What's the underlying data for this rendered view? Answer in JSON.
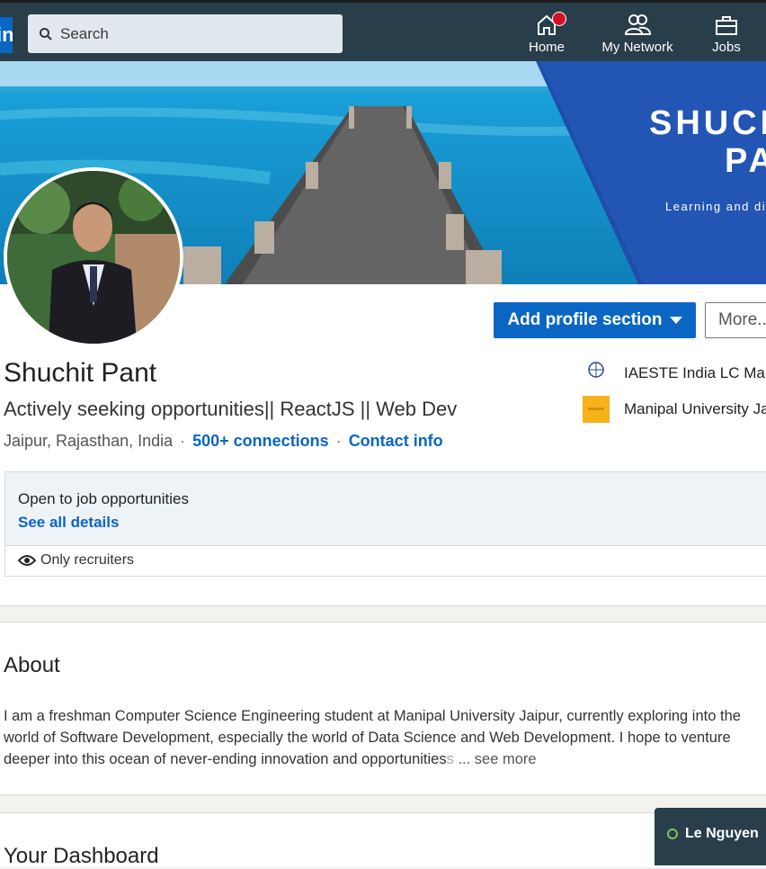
{
  "nav": {
    "logo_text": "in",
    "search_placeholder": "Search",
    "items": [
      {
        "label": "Home"
      },
      {
        "label": "My Network"
      },
      {
        "label": "Jobs"
      }
    ]
  },
  "profile": {
    "banner_title_line1": "SHUCHIT",
    "banner_title_line2": "PANT",
    "banner_tagline": "Learning and discovering",
    "name": "Shuchit Pant",
    "headline": "Actively seeking opportunities|| ReactJS || Web Dev",
    "location": "Jaipur, Rajasthan, India",
    "connections": "500+ connections",
    "contact": "Contact info",
    "add_section_label": "Add profile section",
    "more_label": "More...",
    "orgs": [
      {
        "name": "IAESTE India LC Manipal",
        "logo_text": "IAESTE"
      },
      {
        "name": "Manipal University Jaipur"
      }
    ],
    "job": {
      "title": "Open to job opportunities",
      "details_link": "See all details",
      "visibility": "Only recruiters"
    }
  },
  "about": {
    "heading": "About",
    "text": "I am a freshman Computer Science Engineering student at Manipal University Jaipur, currently exploring into the world of Software Development, especially the world of Data Science and Web Development. I hope to venture deeper into this ocean of never-ending innovation and opportunities",
    "fade_text": "s",
    "see_more": " ... see more"
  },
  "dashboard": {
    "heading": "Your Dashboard"
  },
  "messaging": {
    "name": "Le Nguyen"
  },
  "colors": {
    "brand": "#0a66c2",
    "nav_bg": "#283e4a",
    "notification": "#d11124"
  }
}
